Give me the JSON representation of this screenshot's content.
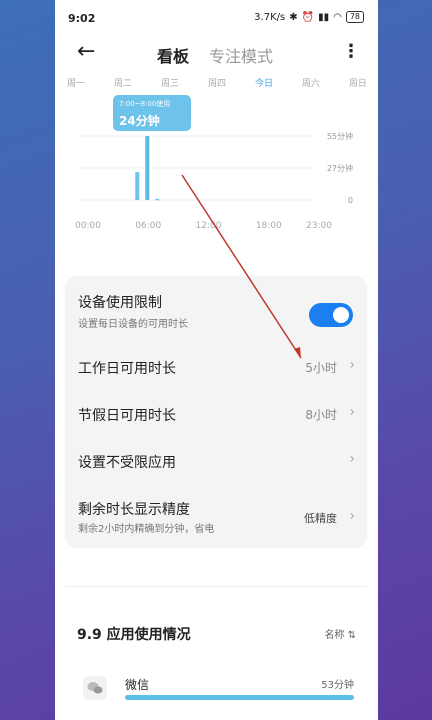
{
  "status_bar": {
    "time": "9:02",
    "speed": "3.7K/s",
    "battery": "78"
  },
  "app_bar": {
    "tab_active": "看板",
    "tab_inactive": "专注模式"
  },
  "weekdays": [
    "周一",
    "周二",
    "周三",
    "周四",
    "今日",
    "周六",
    "周日"
  ],
  "tooltip": {
    "range": "7:00~8:00使用",
    "duration": "24分钟"
  },
  "chart_data": {
    "type": "bar",
    "x_ticks": [
      "00:00",
      "06:00",
      "12:00",
      "18:00",
      "23:00"
    ],
    "y_ticks": [
      "55分钟",
      "27分钟",
      "0"
    ],
    "ylim": [
      0,
      55
    ],
    "hours": [
      6,
      7,
      8
    ],
    "values": [
      24,
      55,
      1
    ],
    "selected_hour": 7
  },
  "settings": {
    "device_limit": {
      "title": "设备使用限制",
      "subtitle": "设置每日设备的可用时长"
    },
    "workday": {
      "title": "工作日可用时长",
      "value": "5小时"
    },
    "holiday": {
      "title": "节假日可用时长",
      "value": "8小时"
    },
    "unlimited_apps": {
      "title": "设置不受限应用"
    },
    "precision": {
      "title": "剩余时长显示精度",
      "subtitle": "剩余2小时内精确到分钟，省电",
      "value": "低精度"
    }
  },
  "usage": {
    "title": "9.9 应用使用情况",
    "sort_label": "名称 ⇅",
    "apps": [
      {
        "name": "微信",
        "time": "53分钟",
        "fraction": 1.0
      }
    ]
  },
  "colors": {
    "accent": "#1c7ff0",
    "bar": "#6ec3ea",
    "annotation": "#c0392b"
  }
}
